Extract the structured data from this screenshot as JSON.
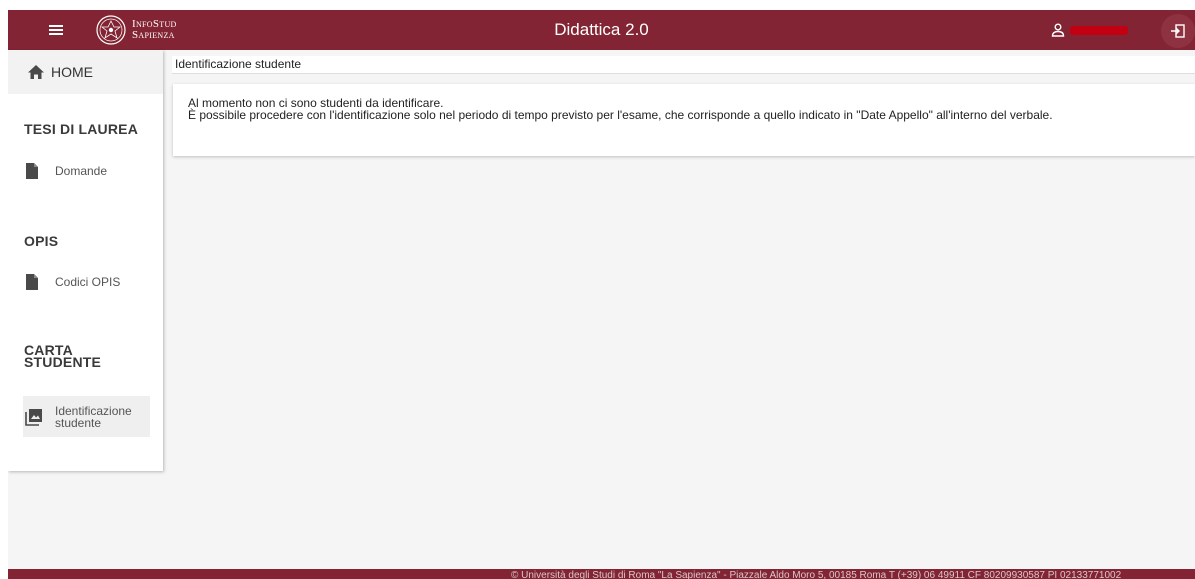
{
  "header": {
    "brand_line1": "InfoStud",
    "brand_line2": "Sapienza",
    "title": "Didattica 2.0",
    "icons": {
      "menu": "hamburger-menu-icon",
      "logo": "sapienza-seal-logo",
      "user": "user-icon",
      "logout": "logout-icon"
    }
  },
  "sidebar": {
    "home_label": "HOME",
    "sections": [
      {
        "title": "TESI DI LAUREA",
        "items": [
          {
            "label": "Domande",
            "icon": "document-icon"
          }
        ]
      },
      {
        "title": "OPIS",
        "items": [
          {
            "label": "Codici OPIS",
            "icon": "document-icon"
          }
        ]
      },
      {
        "title_line1": "CARTA",
        "title_line2": "STUDENTE",
        "items": [
          {
            "label_line1": "Identificazione",
            "label_line2": "studente",
            "icon": "image-gallery-icon",
            "active": true
          }
        ]
      }
    ]
  },
  "main": {
    "breadcrumb": "Identificazione studente",
    "message_line1": "Al momento non ci sono studenti da identificare.",
    "message_line2": "È possibile procedere con l'identificazione solo nel periodo di tempo previsto per l'esame, che corrisponde a quello indicato in \"Date Appello\" all'interno del verbale."
  },
  "footer": {
    "text": "© Università degli Studi di Roma \"La Sapienza\" - Piazzale Aldo Moro 5, 00185 Roma T (+39) 06 49911 CF 80209930587 PI 02133771002"
  },
  "colors": {
    "brand": "#822433",
    "background": "#f5f5f5",
    "redacted_name": "#c20012"
  }
}
